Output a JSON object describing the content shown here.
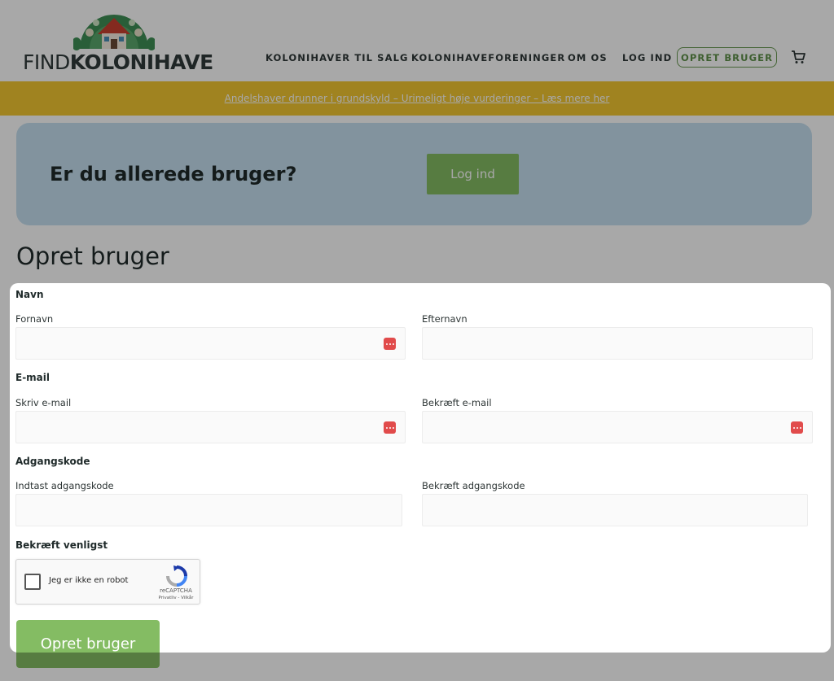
{
  "header": {
    "logo_thin": "FIND",
    "logo_bold": "KOLONIHAVE",
    "nav": [
      "KOLONIHAVER TIL SALG",
      "KOLONIHAVEFORENINGER",
      "OM OS",
      "LOG IND"
    ],
    "signup_label": "OPRET BRUGER"
  },
  "banner": {
    "text": "Andelshaver drunner i grundskyld – Urimeligt høje vurderinger – Læs mere her"
  },
  "login_card": {
    "title": "Er du allerede bruger?",
    "button": "Log ind"
  },
  "page_title": "Opret bruger",
  "form": {
    "name_section": "Navn",
    "first_name_label": "Fornavn",
    "last_name_label": "Efternavn",
    "email_section": "E-mail",
    "email_label": "Skriv e-mail",
    "email_confirm_label": "Bekræft e-mail",
    "password_section": "Adgangskode",
    "password_label": "Indtast adgangskode",
    "password_confirm_label": "Bekræft adgangskode",
    "captcha_section": "Bekræft venligst",
    "captcha": {
      "label": "Jeg er ikke en robot",
      "brand": "reCAPTCHA",
      "links": "Privatliv - Vilkår"
    },
    "submit": "Opret bruger"
  },
  "colors": {
    "accent_green": "#84bc63",
    "banner_yellow": "#f3c731",
    "login_card_blue": "#c6e0f0",
    "password_icon_red": "#e14b4b"
  }
}
